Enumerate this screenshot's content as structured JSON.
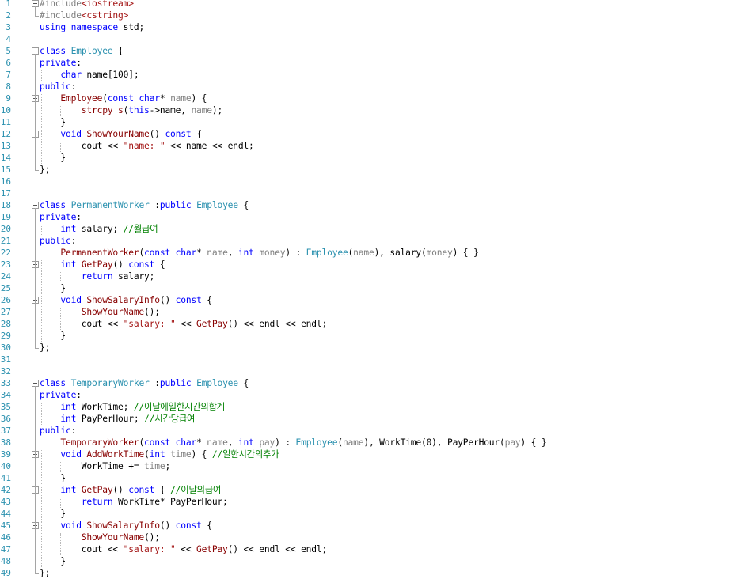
{
  "editor": {
    "lines": [
      [
        {
          "t": "#include",
          "c": "pp"
        },
        {
          "t": "<iostream>",
          "c": "str"
        }
      ],
      [
        {
          "t": "#include",
          "c": "pp"
        },
        {
          "t": "<cstring>",
          "c": "str"
        }
      ],
      [
        {
          "t": "using",
          "c": "kw"
        },
        {
          "t": " ",
          "c": "plain"
        },
        {
          "t": "namespace",
          "c": "kw"
        },
        {
          "t": " std;",
          "c": "plain"
        }
      ],
      [],
      [
        {
          "t": "class",
          "c": "kw"
        },
        {
          "t": " ",
          "c": "plain"
        },
        {
          "t": "Employee",
          "c": "type"
        },
        {
          "t": " {",
          "c": "plain"
        }
      ],
      [
        {
          "t": "private",
          "c": "kw"
        },
        {
          "t": ":",
          "c": "plain"
        }
      ],
      [
        {
          "t": "    ",
          "c": "plain"
        },
        {
          "t": "char",
          "c": "kw"
        },
        {
          "t": " name[100];",
          "c": "plain"
        }
      ],
      [
        {
          "t": "public",
          "c": "kw"
        },
        {
          "t": ":",
          "c": "plain"
        }
      ],
      [
        {
          "t": "    ",
          "c": "plain"
        },
        {
          "t": "Employee",
          "c": "fn"
        },
        {
          "t": "(",
          "c": "plain"
        },
        {
          "t": "const",
          "c": "kw"
        },
        {
          "t": " ",
          "c": "plain"
        },
        {
          "t": "char",
          "c": "kw"
        },
        {
          "t": "* ",
          "c": "plain"
        },
        {
          "t": "name",
          "c": "param"
        },
        {
          "t": ") {",
          "c": "plain"
        }
      ],
      [
        {
          "t": "        ",
          "c": "plain"
        },
        {
          "t": "strcpy_s",
          "c": "fn"
        },
        {
          "t": "(",
          "c": "plain"
        },
        {
          "t": "this",
          "c": "kw"
        },
        {
          "t": "->name, ",
          "c": "plain"
        },
        {
          "t": "name",
          "c": "param"
        },
        {
          "t": ");",
          "c": "plain"
        }
      ],
      [
        {
          "t": "    }",
          "c": "plain"
        }
      ],
      [
        {
          "t": "    ",
          "c": "plain"
        },
        {
          "t": "void",
          "c": "kw"
        },
        {
          "t": " ",
          "c": "plain"
        },
        {
          "t": "ShowYourName",
          "c": "fn"
        },
        {
          "t": "() ",
          "c": "plain"
        },
        {
          "t": "const",
          "c": "kw"
        },
        {
          "t": " {",
          "c": "plain"
        }
      ],
      [
        {
          "t": "        cout << ",
          "c": "plain"
        },
        {
          "t": "\"name: \"",
          "c": "str"
        },
        {
          "t": " << name << endl;",
          "c": "plain"
        }
      ],
      [
        {
          "t": "    }",
          "c": "plain"
        }
      ],
      [
        {
          "t": "};",
          "c": "plain"
        }
      ],
      [],
      [],
      [
        {
          "t": "class",
          "c": "kw"
        },
        {
          "t": " ",
          "c": "plain"
        },
        {
          "t": "PermanentWorker",
          "c": "type"
        },
        {
          "t": " :",
          "c": "plain"
        },
        {
          "t": "public",
          "c": "kw"
        },
        {
          "t": " ",
          "c": "plain"
        },
        {
          "t": "Employee",
          "c": "type"
        },
        {
          "t": " {",
          "c": "plain"
        }
      ],
      [
        {
          "t": "private",
          "c": "kw"
        },
        {
          "t": ":",
          "c": "plain"
        }
      ],
      [
        {
          "t": "    ",
          "c": "plain"
        },
        {
          "t": "int",
          "c": "kw"
        },
        {
          "t": " salary; ",
          "c": "plain"
        },
        {
          "t": "//월급여",
          "c": "cmt"
        }
      ],
      [
        {
          "t": "public",
          "c": "kw"
        },
        {
          "t": ":",
          "c": "plain"
        }
      ],
      [
        {
          "t": "    ",
          "c": "plain"
        },
        {
          "t": "PermanentWorker",
          "c": "fn"
        },
        {
          "t": "(",
          "c": "plain"
        },
        {
          "t": "const",
          "c": "kw"
        },
        {
          "t": " ",
          "c": "plain"
        },
        {
          "t": "char",
          "c": "kw"
        },
        {
          "t": "* ",
          "c": "plain"
        },
        {
          "t": "name",
          "c": "param"
        },
        {
          "t": ", ",
          "c": "plain"
        },
        {
          "t": "int",
          "c": "kw"
        },
        {
          "t": " ",
          "c": "plain"
        },
        {
          "t": "money",
          "c": "param"
        },
        {
          "t": ") : ",
          "c": "plain"
        },
        {
          "t": "Employee",
          "c": "type"
        },
        {
          "t": "(",
          "c": "plain"
        },
        {
          "t": "name",
          "c": "param"
        },
        {
          "t": "), salary(",
          "c": "plain"
        },
        {
          "t": "money",
          "c": "param"
        },
        {
          "t": ") { }",
          "c": "plain"
        }
      ],
      [
        {
          "t": "    ",
          "c": "plain"
        },
        {
          "t": "int",
          "c": "kw"
        },
        {
          "t": " ",
          "c": "plain"
        },
        {
          "t": "GetPay",
          "c": "fn"
        },
        {
          "t": "() ",
          "c": "plain"
        },
        {
          "t": "const",
          "c": "kw"
        },
        {
          "t": " {",
          "c": "plain"
        }
      ],
      [
        {
          "t": "        ",
          "c": "plain"
        },
        {
          "t": "return",
          "c": "kw"
        },
        {
          "t": " salary;",
          "c": "plain"
        }
      ],
      [
        {
          "t": "    }",
          "c": "plain"
        }
      ],
      [
        {
          "t": "    ",
          "c": "plain"
        },
        {
          "t": "void",
          "c": "kw"
        },
        {
          "t": " ",
          "c": "plain"
        },
        {
          "t": "ShowSalaryInfo",
          "c": "fn"
        },
        {
          "t": "() ",
          "c": "plain"
        },
        {
          "t": "const",
          "c": "kw"
        },
        {
          "t": " {",
          "c": "plain"
        }
      ],
      [
        {
          "t": "        ",
          "c": "plain"
        },
        {
          "t": "ShowYourName",
          "c": "fn"
        },
        {
          "t": "();",
          "c": "plain"
        }
      ],
      [
        {
          "t": "        cout << ",
          "c": "plain"
        },
        {
          "t": "\"salary: \"",
          "c": "str"
        },
        {
          "t": " << ",
          "c": "plain"
        },
        {
          "t": "GetPay",
          "c": "fn"
        },
        {
          "t": "() << endl << endl;",
          "c": "plain"
        }
      ],
      [
        {
          "t": "    }",
          "c": "plain"
        }
      ],
      [
        {
          "t": "};",
          "c": "plain"
        }
      ],
      [],
      [],
      [
        {
          "t": "class",
          "c": "kw"
        },
        {
          "t": " ",
          "c": "plain"
        },
        {
          "t": "TemporaryWorker",
          "c": "type"
        },
        {
          "t": " :",
          "c": "plain"
        },
        {
          "t": "public",
          "c": "kw"
        },
        {
          "t": " ",
          "c": "plain"
        },
        {
          "t": "Employee",
          "c": "type"
        },
        {
          "t": " {",
          "c": "plain"
        }
      ],
      [
        {
          "t": "private",
          "c": "kw"
        },
        {
          "t": ":",
          "c": "plain"
        }
      ],
      [
        {
          "t": "    ",
          "c": "plain"
        },
        {
          "t": "int",
          "c": "kw"
        },
        {
          "t": " WorkTime; ",
          "c": "plain"
        },
        {
          "t": "//이달에일한시간의합계",
          "c": "cmt"
        }
      ],
      [
        {
          "t": "    ",
          "c": "plain"
        },
        {
          "t": "int",
          "c": "kw"
        },
        {
          "t": " PayPerHour; ",
          "c": "plain"
        },
        {
          "t": "//시간당급여",
          "c": "cmt"
        }
      ],
      [
        {
          "t": "public",
          "c": "kw"
        },
        {
          "t": ":",
          "c": "plain"
        }
      ],
      [
        {
          "t": "    ",
          "c": "plain"
        },
        {
          "t": "TemporaryWorker",
          "c": "fn"
        },
        {
          "t": "(",
          "c": "plain"
        },
        {
          "t": "const",
          "c": "kw"
        },
        {
          "t": " ",
          "c": "plain"
        },
        {
          "t": "char",
          "c": "kw"
        },
        {
          "t": "* ",
          "c": "plain"
        },
        {
          "t": "name",
          "c": "param"
        },
        {
          "t": ", ",
          "c": "plain"
        },
        {
          "t": "int",
          "c": "kw"
        },
        {
          "t": " ",
          "c": "plain"
        },
        {
          "t": "pay",
          "c": "param"
        },
        {
          "t": ") : ",
          "c": "plain"
        },
        {
          "t": "Employee",
          "c": "type"
        },
        {
          "t": "(",
          "c": "plain"
        },
        {
          "t": "name",
          "c": "param"
        },
        {
          "t": "), WorkTime(0), PayPerHour(",
          "c": "plain"
        },
        {
          "t": "pay",
          "c": "param"
        },
        {
          "t": ") { }",
          "c": "plain"
        }
      ],
      [
        {
          "t": "    ",
          "c": "plain"
        },
        {
          "t": "void",
          "c": "kw"
        },
        {
          "t": " ",
          "c": "plain"
        },
        {
          "t": "AddWorkTime",
          "c": "fn"
        },
        {
          "t": "(",
          "c": "plain"
        },
        {
          "t": "int",
          "c": "kw"
        },
        {
          "t": " ",
          "c": "plain"
        },
        {
          "t": "time",
          "c": "param"
        },
        {
          "t": ") { ",
          "c": "plain"
        },
        {
          "t": "//일한시간의추가",
          "c": "cmt"
        }
      ],
      [
        {
          "t": "        WorkTime += ",
          "c": "plain"
        },
        {
          "t": "time",
          "c": "param"
        },
        {
          "t": ";",
          "c": "plain"
        }
      ],
      [
        {
          "t": "    }",
          "c": "plain"
        }
      ],
      [
        {
          "t": "    ",
          "c": "plain"
        },
        {
          "t": "int",
          "c": "kw"
        },
        {
          "t": " ",
          "c": "plain"
        },
        {
          "t": "GetPay",
          "c": "fn"
        },
        {
          "t": "() ",
          "c": "plain"
        },
        {
          "t": "const",
          "c": "kw"
        },
        {
          "t": " { ",
          "c": "plain"
        },
        {
          "t": "//이달의급여",
          "c": "cmt"
        }
      ],
      [
        {
          "t": "        ",
          "c": "plain"
        },
        {
          "t": "return",
          "c": "kw"
        },
        {
          "t": " WorkTime* PayPerHour;",
          "c": "plain"
        }
      ],
      [
        {
          "t": "    }",
          "c": "plain"
        }
      ],
      [
        {
          "t": "    ",
          "c": "plain"
        },
        {
          "t": "void",
          "c": "kw"
        },
        {
          "t": " ",
          "c": "plain"
        },
        {
          "t": "ShowSalaryInfo",
          "c": "fn"
        },
        {
          "t": "() ",
          "c": "plain"
        },
        {
          "t": "const",
          "c": "kw"
        },
        {
          "t": " {",
          "c": "plain"
        }
      ],
      [
        {
          "t": "        ",
          "c": "plain"
        },
        {
          "t": "ShowYourName",
          "c": "fn"
        },
        {
          "t": "();",
          "c": "plain"
        }
      ],
      [
        {
          "t": "        cout << ",
          "c": "plain"
        },
        {
          "t": "\"salary: \"",
          "c": "str"
        },
        {
          "t": " << ",
          "c": "plain"
        },
        {
          "t": "GetPay",
          "c": "fn"
        },
        {
          "t": "() << endl << endl;",
          "c": "plain"
        }
      ],
      [
        {
          "t": "    }",
          "c": "plain"
        }
      ],
      [
        {
          "t": "};",
          "c": "plain"
        }
      ]
    ],
    "fold_lines": [
      1,
      5,
      9,
      12,
      18,
      23,
      26,
      33,
      39,
      42,
      45
    ]
  },
  "colors": {
    "line_number": "#2b91af",
    "keyword": "#0000ff",
    "type": "#2b91af",
    "string": "#a31515",
    "comment": "#008000",
    "parameter": "#808080",
    "preprocessor": "#808080"
  }
}
